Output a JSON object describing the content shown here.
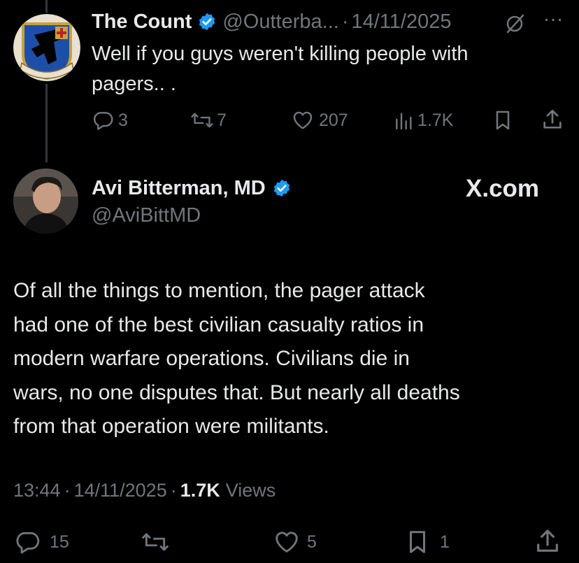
{
  "parent_tweet": {
    "display_name": "The Count",
    "handle": "@Outterba...",
    "separator": "·",
    "date": "14/11/2025",
    "text_line1": "Well if you guys weren't killing people with",
    "text_line2": "pagers.. .",
    "more_icon": "…",
    "actions": {
      "replies": "3",
      "reposts": "7",
      "likes": "207",
      "views": "1.7K"
    }
  },
  "main_tweet": {
    "display_name": "Avi Bitterman, MD",
    "handle": "@AviBittMD",
    "logo": "X.com",
    "text": [
      "Of all the things to mention, the pager attack",
      "had one of the best civilian casualty ratios in",
      "modern warfare operations. Civilians die in",
      "wars, no one disputes that. But nearly all deaths",
      "from that operation were militants."
    ],
    "time": "13:44",
    "dot": "·",
    "date": "14/11/2025",
    "views_count": "1.7K",
    "views_label": "Views",
    "actions": {
      "replies": "15",
      "likes": "5",
      "bookmarks": "1"
    }
  },
  "colors": {
    "background": "#000000",
    "text": "#e7e9ea",
    "muted": "#71767b",
    "verified": "#1d9bf0",
    "thread_line": "#333639"
  }
}
